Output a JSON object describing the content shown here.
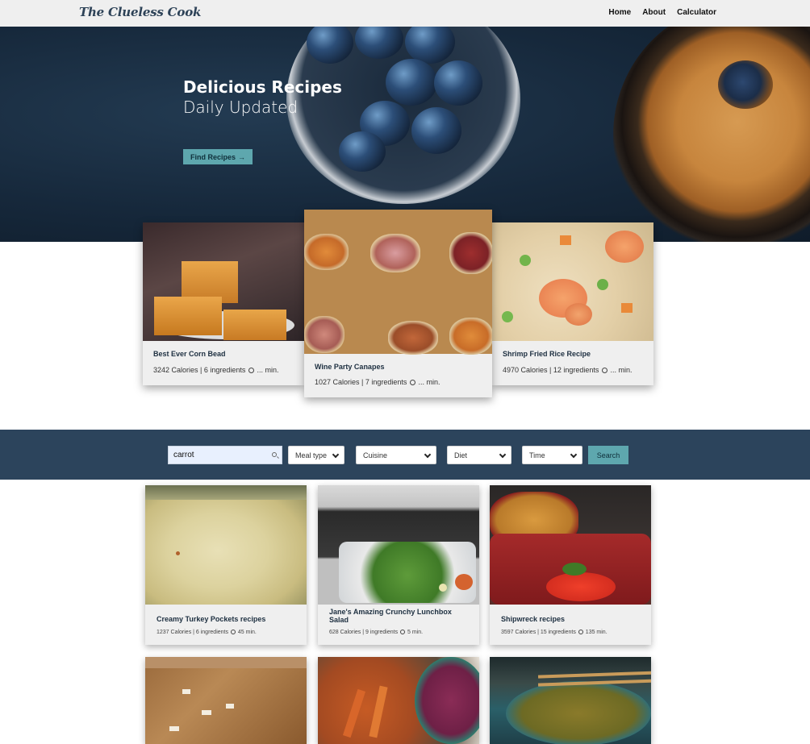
{
  "nav": {
    "logo": "The Clueless Cook",
    "links": [
      "Home",
      "About",
      "Calculator"
    ]
  },
  "hero": {
    "title": "Delicious Recipes",
    "subtitle": "Daily Updated",
    "button": "Find Recipes",
    "button_icon": "arrow-right-icon"
  },
  "featured": [
    {
      "title": "Best Ever Corn Bead",
      "meta_before": "3242 Calories | 6 ingredients",
      "meta_after": "... min."
    },
    {
      "title": "Wine Party Canapes",
      "meta_before": "1027 Calories | 7 ingredients",
      "meta_after": "... min."
    },
    {
      "title": "Shrimp Fried Rice Recipe",
      "meta_before": "4970 Calories | 12 ingredients",
      "meta_after": "... min."
    }
  ],
  "search": {
    "value": "carrot",
    "filters": [
      "Meal type",
      "Cuisine",
      "Diet",
      "Time"
    ],
    "button": "Search"
  },
  "results": [
    {
      "title": "Creamy Turkey Pockets recipes",
      "meta_before": "1237 Calories | 6 ingredients",
      "meta_after": "45 min."
    },
    {
      "title": "Jane's Amazing Crunchy Lunchbox Salad",
      "meta_before": "628 Calories | 9 ingredients",
      "meta_after": "5 min."
    },
    {
      "title": "Shipwreck recipes",
      "meta_before": "3597 Calories | 15 ingredients",
      "meta_after": "135 min."
    }
  ],
  "colors": {
    "nav_bg": "#efefef",
    "accent": "#5ea7ae",
    "search_band": "#2c445c",
    "card_bg": "#efefef",
    "title_text": "#1d2f40"
  }
}
